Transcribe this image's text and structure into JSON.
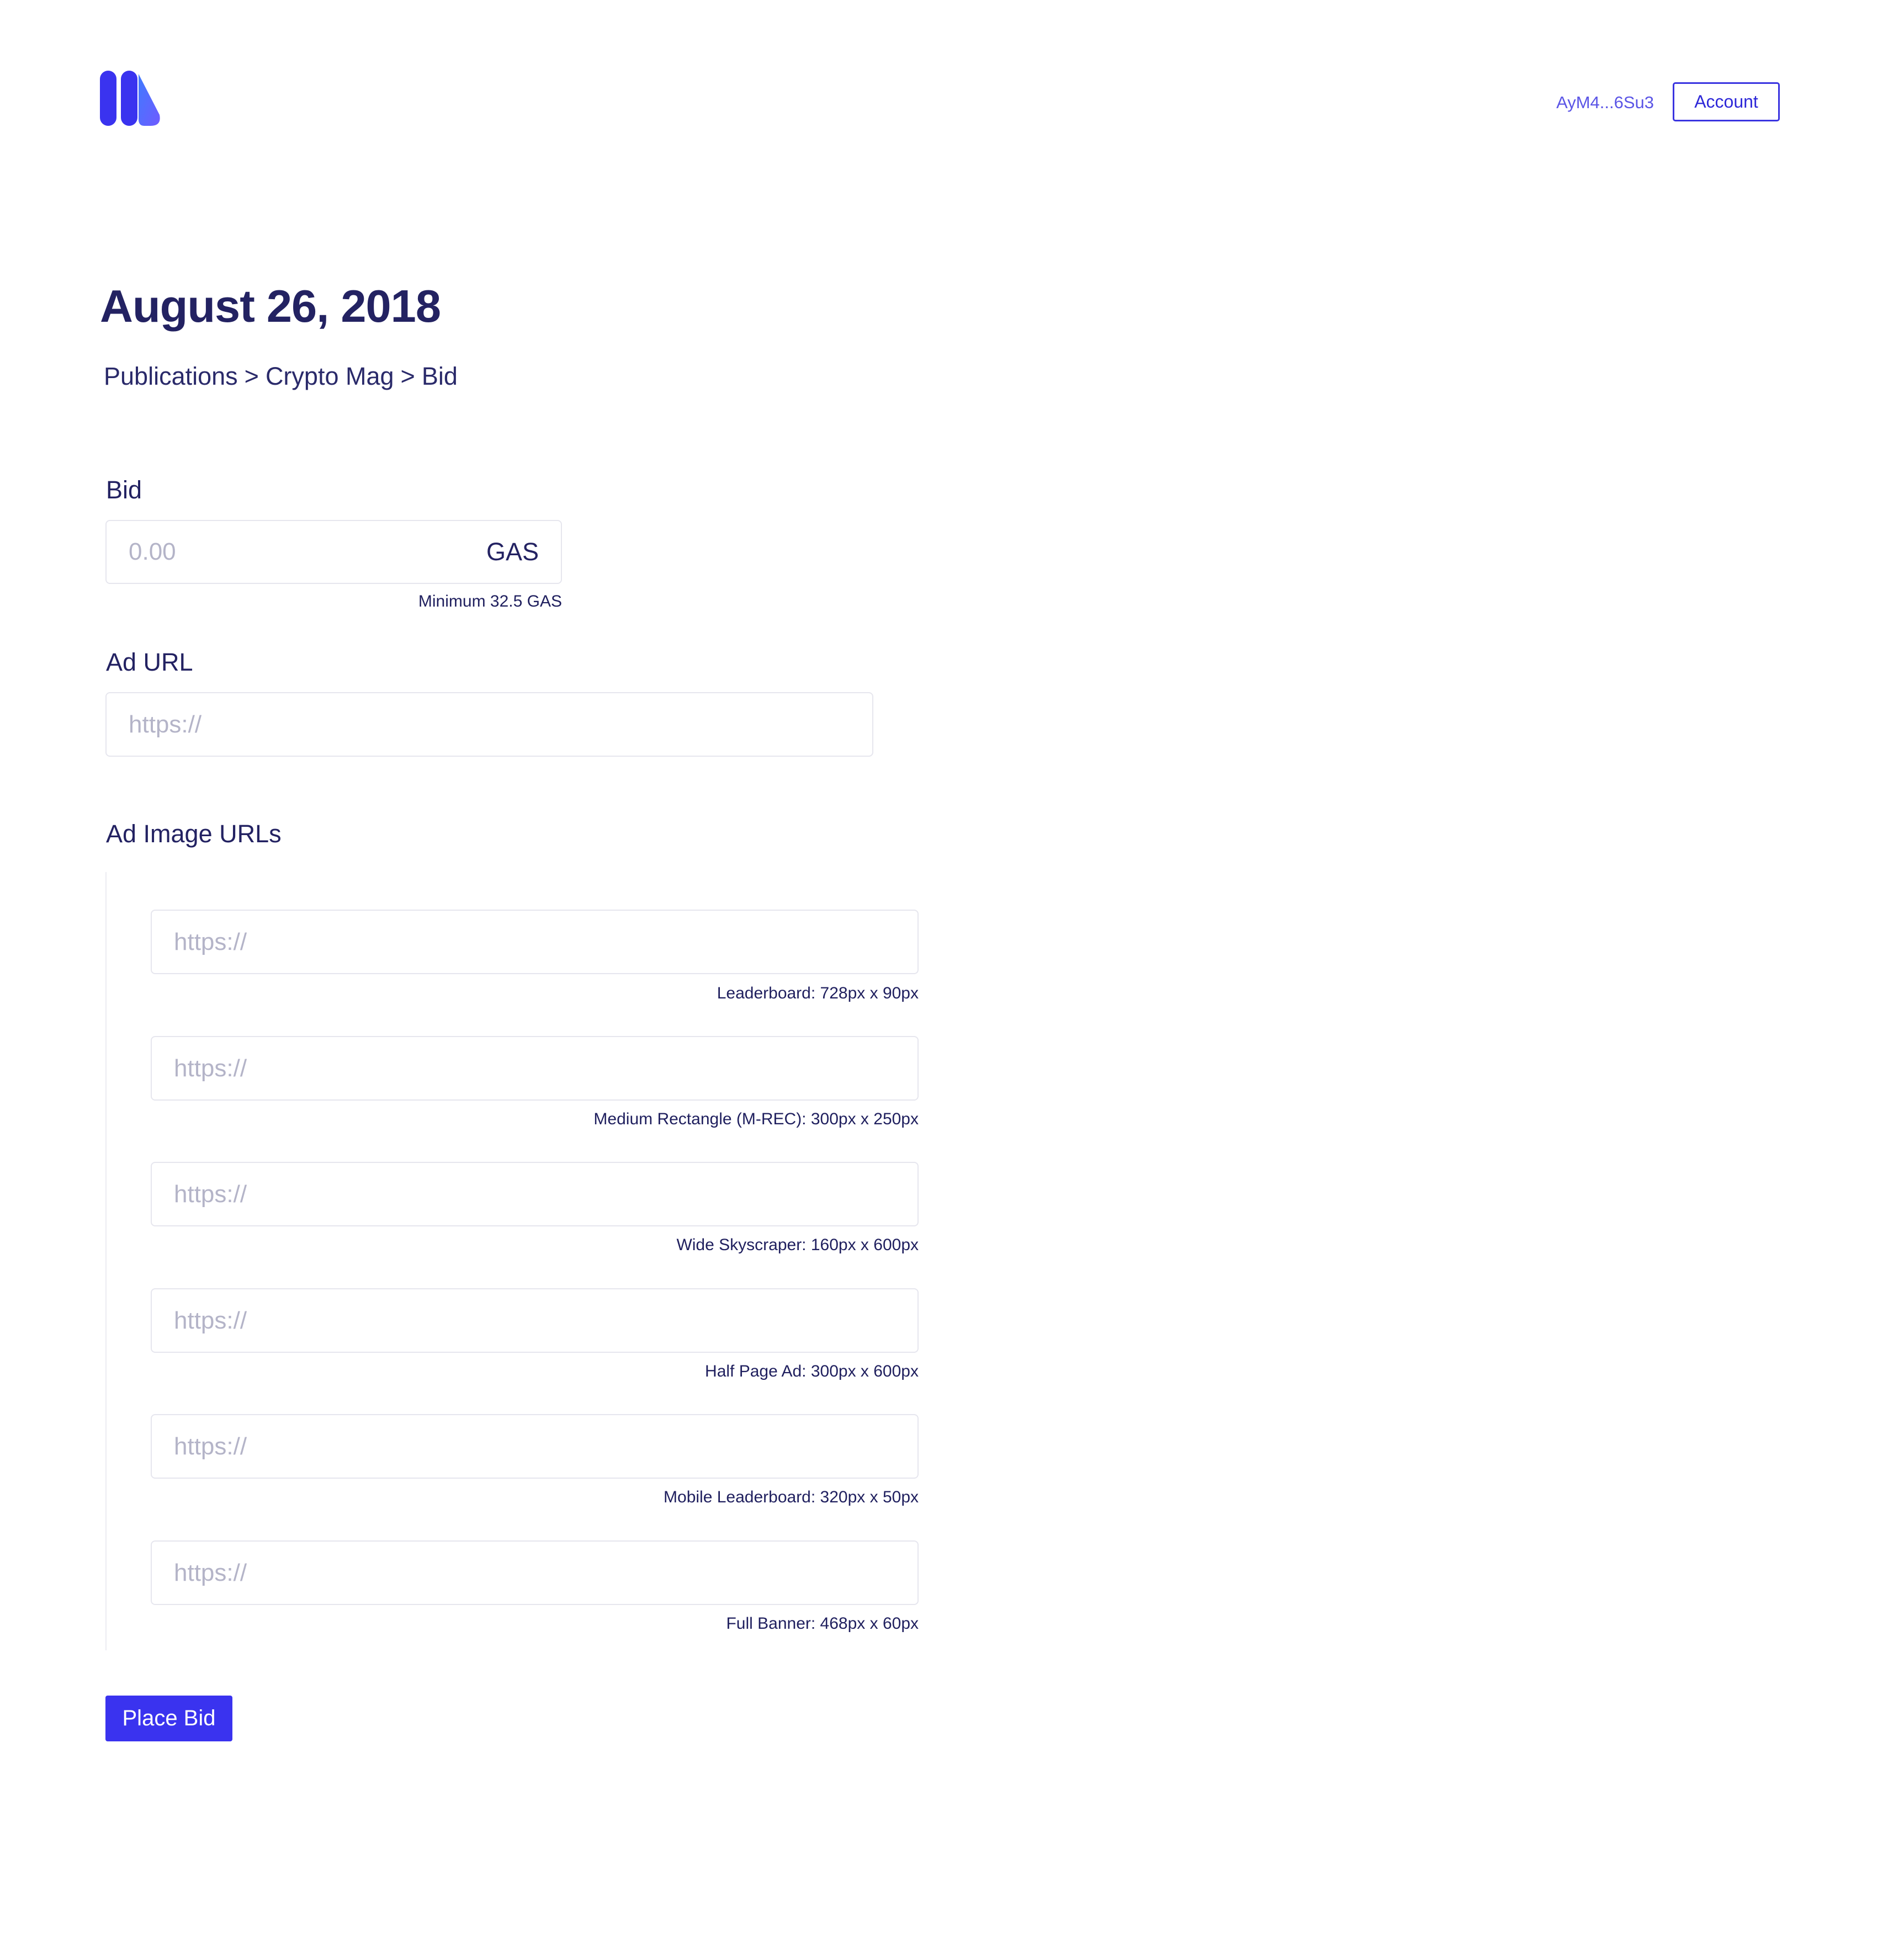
{
  "header": {
    "logo_icon": "brand-logo-icon",
    "wallet_address": "AyM4...6Su3",
    "account_label": "Account",
    "brand_color": "#3a33ef"
  },
  "page": {
    "title": "August 26, 2018",
    "breadcrumb": [
      {
        "label": "Publications"
      },
      {
        "label": "Crypto Mag"
      },
      {
        "label": "Bid"
      }
    ],
    "breadcrumb_separator": ">"
  },
  "form": {
    "bid": {
      "label": "Bid",
      "placeholder": "0.00",
      "value": "",
      "currency": "GAS",
      "hint": "Minimum 32.5 GAS"
    },
    "ad_url": {
      "label": "Ad URL",
      "placeholder": "https://",
      "value": ""
    },
    "ad_image_urls": {
      "label": "Ad Image URLs",
      "items": [
        {
          "placeholder": "https://",
          "value": "",
          "hint": "Leaderboard: 728px x 90px"
        },
        {
          "placeholder": "https://",
          "value": "",
          "hint": "Medium Rectangle (M-REC): 300px x 250px"
        },
        {
          "placeholder": "https://",
          "value": "",
          "hint": "Wide Skyscraper: 160px x 600px"
        },
        {
          "placeholder": "https://",
          "value": "",
          "hint": "Half Page Ad: 300px x 600px"
        },
        {
          "placeholder": "https://",
          "value": "",
          "hint": "Mobile Leaderboard: 320px x 50px"
        },
        {
          "placeholder": "https://",
          "value": "",
          "hint": "Full Banner: 468px x 60px"
        }
      ]
    },
    "submit_label": "Place Bid"
  }
}
